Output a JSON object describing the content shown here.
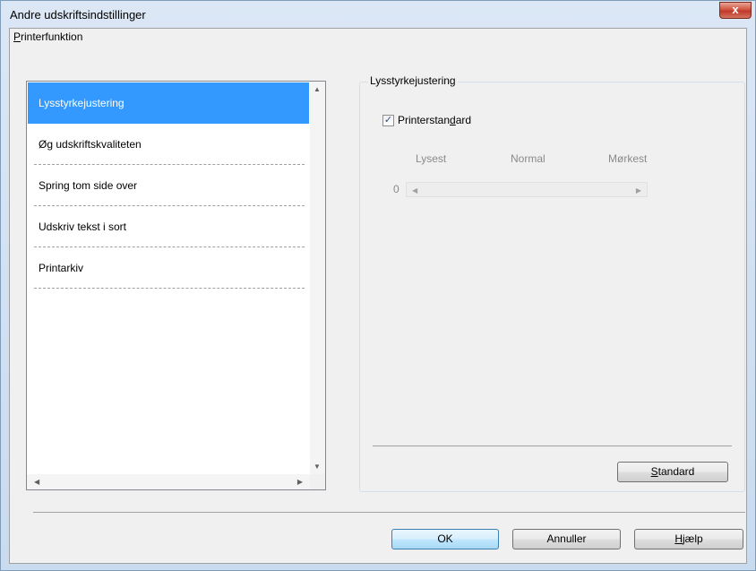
{
  "window": {
    "title": "Andre udskriftsindstillinger",
    "close_glyph": "x"
  },
  "printer_function": {
    "label_accel": "P",
    "label_rest": "rinterfunktion",
    "items": [
      {
        "label": "Lysstyrkejustering",
        "selected": true
      },
      {
        "label": "Øg udskriftskvaliteten",
        "selected": false
      },
      {
        "label": "Spring tom side over",
        "selected": false
      },
      {
        "label": "Udskriv tekst i sort",
        "selected": false
      },
      {
        "label": "Printarkiv",
        "selected": false
      }
    ]
  },
  "brightness": {
    "group_title": "Lysstyrkejustering",
    "checkbox_checked": true,
    "checkbox_label_pre": "Printerstan",
    "checkbox_label_accel": "d",
    "checkbox_label_post": "ard",
    "scale": {
      "lightest": "Lysest",
      "normal": "Normal",
      "darkest": "Mørkest"
    },
    "slider_value": "0",
    "standard_button_accel": "S",
    "standard_button_rest": "tandard"
  },
  "footer": {
    "ok_label": "OK",
    "cancel_label": "Annuller",
    "help_accel": "H",
    "help_rest": "jælp"
  },
  "icons": {
    "close": "close-icon",
    "check": "checkmark-icon",
    "scroll_up": "triangle-up-icon",
    "scroll_down": "triangle-down-icon",
    "scroll_left": "triangle-left-icon",
    "scroll_right": "triangle-right-icon"
  },
  "colors": {
    "selection": "#3399ff",
    "close_button": "#c0392b",
    "default_button_border": "#3c7fb1"
  }
}
